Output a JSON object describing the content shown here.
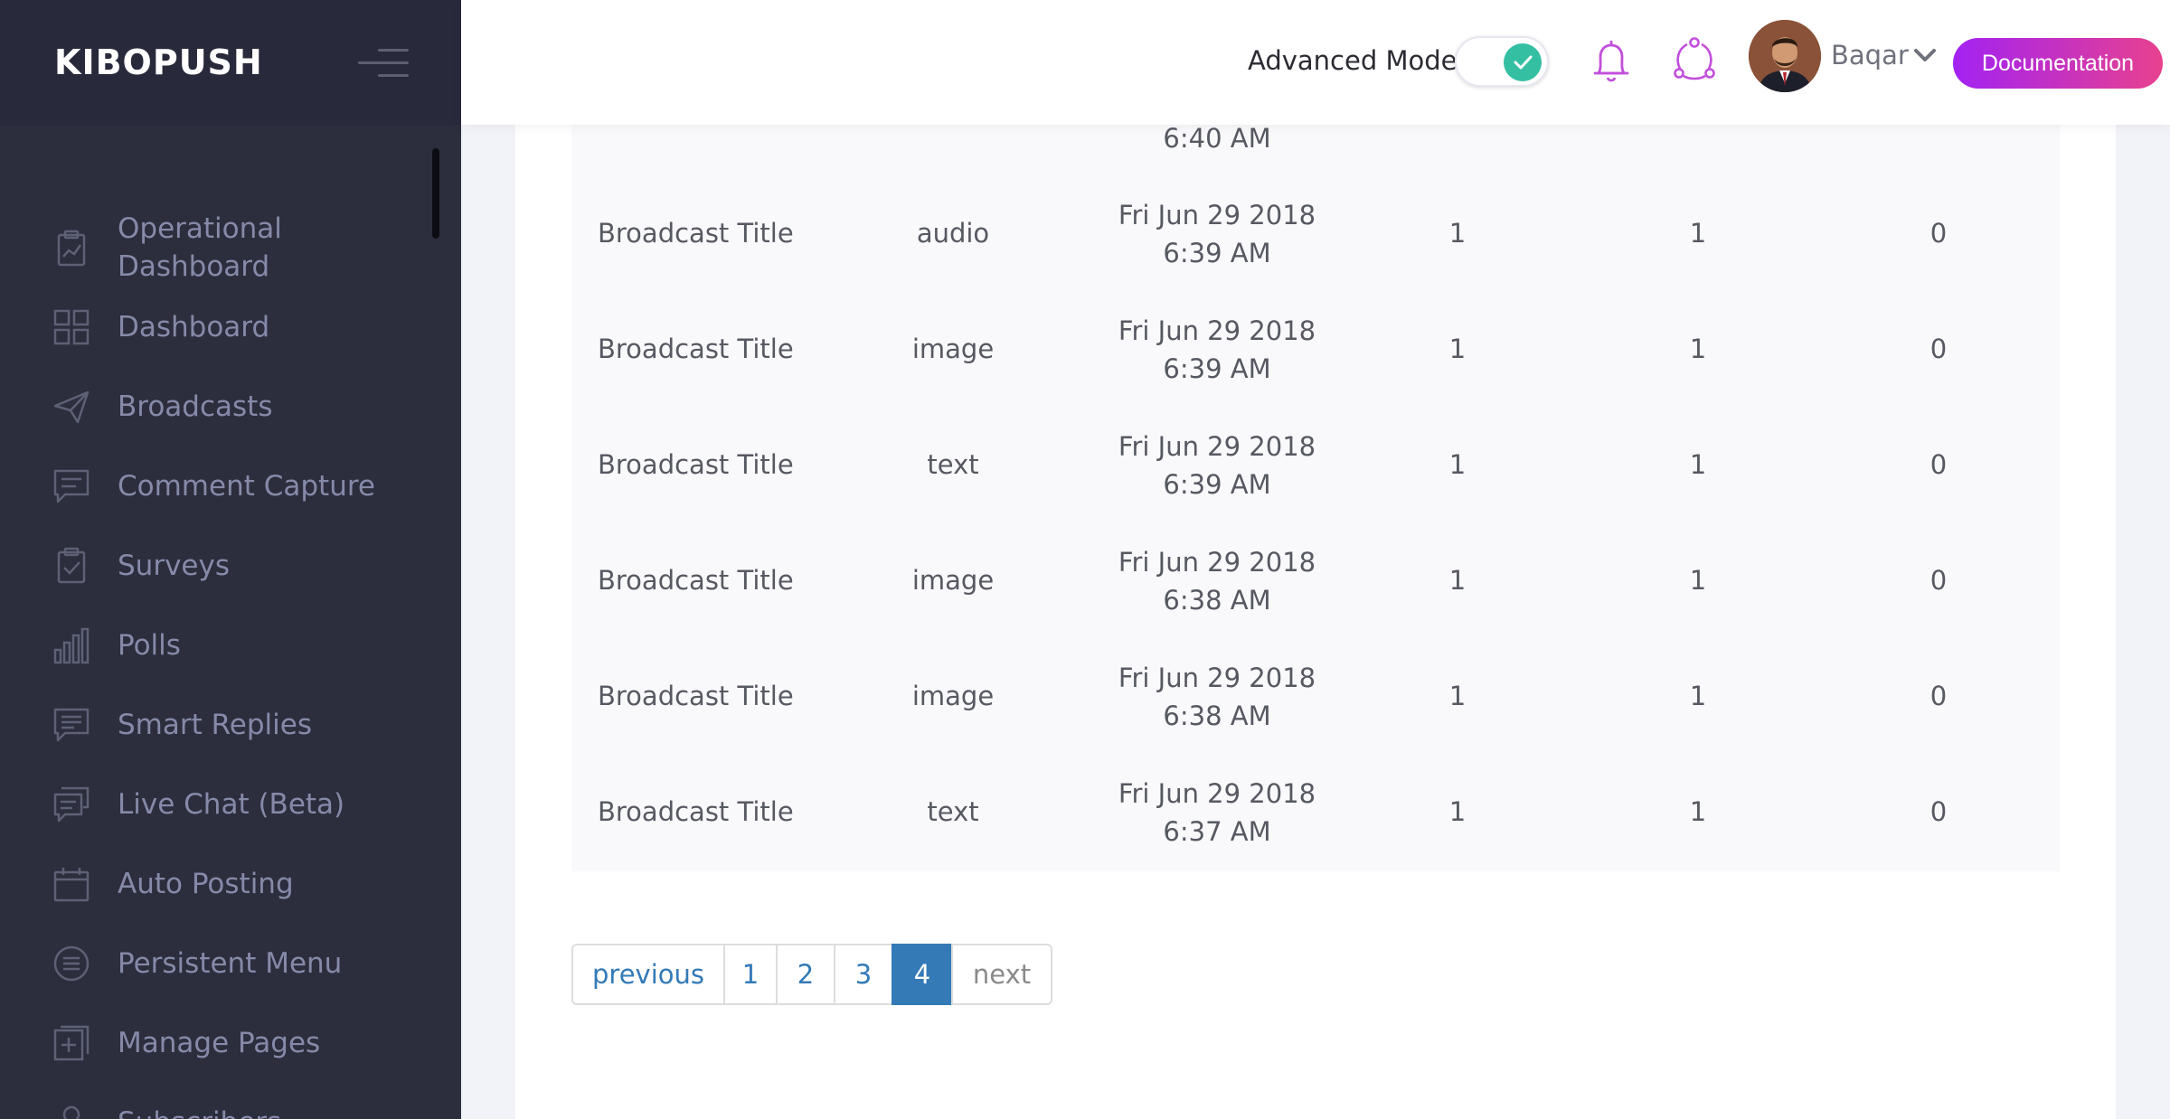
{
  "sidebar": {
    "brand": "KIBOPUSH",
    "items": [
      {
        "label": "Operational Dashboard",
        "icon": "clipboard-chart-icon"
      },
      {
        "label": "Dashboard",
        "icon": "grid-icon"
      },
      {
        "label": "Broadcasts",
        "icon": "paper-plane-icon"
      },
      {
        "label": "Comment Capture",
        "icon": "comment-icon"
      },
      {
        "label": "Surveys",
        "icon": "clipboard-check-icon"
      },
      {
        "label": "Polls",
        "icon": "bar-chart-icon"
      },
      {
        "label": "Smart Replies",
        "icon": "chat-lines-icon"
      },
      {
        "label": "Live Chat (Beta)",
        "icon": "chat-bubbles-icon"
      },
      {
        "label": "Auto Posting",
        "icon": "calendar-icon"
      },
      {
        "label": "Persistent Menu",
        "icon": "list-circle-icon"
      },
      {
        "label": "Manage Pages",
        "icon": "add-page-icon"
      },
      {
        "label": "Subscribers",
        "icon": "user-icon"
      }
    ]
  },
  "header": {
    "advanced_mode_label": "Advanced Mode",
    "advanced_mode_on": true,
    "user_name": "Baqar",
    "documentation_label": "Documentation",
    "colors": {
      "toggle_on": "#34bfa3",
      "icon_accent": "#c24fdb",
      "doc_gradient_start": "#a222f2",
      "doc_gradient_end": "#e8418f"
    }
  },
  "table": {
    "partial_row": {
      "date_time": "6:40 AM"
    },
    "rows": [
      {
        "title": "Broadcast Title",
        "type": "audio",
        "date": "Fri Jun 29 2018",
        "time": "6:39 AM",
        "col4": "1",
        "col5": "1",
        "col6": "0"
      },
      {
        "title": "Broadcast Title",
        "type": "image",
        "date": "Fri Jun 29 2018",
        "time": "6:39 AM",
        "col4": "1",
        "col5": "1",
        "col6": "0"
      },
      {
        "title": "Broadcast Title",
        "type": "text",
        "date": "Fri Jun 29 2018",
        "time": "6:39 AM",
        "col4": "1",
        "col5": "1",
        "col6": "0"
      },
      {
        "title": "Broadcast Title",
        "type": "image",
        "date": "Fri Jun 29 2018",
        "time": "6:38 AM",
        "col4": "1",
        "col5": "1",
        "col6": "0"
      },
      {
        "title": "Broadcast Title",
        "type": "image",
        "date": "Fri Jun 29 2018",
        "time": "6:38 AM",
        "col4": "1",
        "col5": "1",
        "col6": "0"
      },
      {
        "title": "Broadcast Title",
        "type": "text",
        "date": "Fri Jun 29 2018",
        "time": "6:37 AM",
        "col4": "1",
        "col5": "1",
        "col6": "0"
      }
    ]
  },
  "pagination": {
    "previous": "previous",
    "pages": [
      "1",
      "2",
      "3",
      "4"
    ],
    "current": "4",
    "next": "next"
  }
}
